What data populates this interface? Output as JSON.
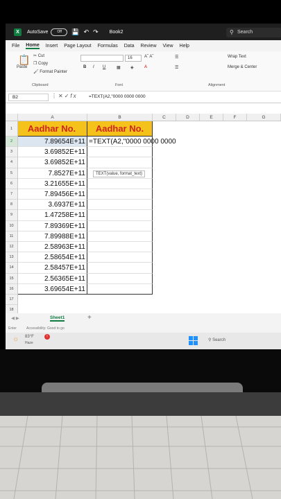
{
  "titlebar": {
    "app_icon": "X",
    "autosave_label": "AutoSave",
    "autosave_state": "Off",
    "book_name": "Book2",
    "search_placeholder": "Search"
  },
  "tabs": [
    "File",
    "Home",
    "Insert",
    "Page Layout",
    "Formulas",
    "Data",
    "Review",
    "View",
    "Help"
  ],
  "active_tab": "Home",
  "ribbon": {
    "cut": "Cut",
    "copy": "Copy",
    "paste": "Paste",
    "format_painter": "Format Painter",
    "clipboard": "Clipboard",
    "font_size": "16",
    "font_group": "Font",
    "wrap_text": "Wrap Text",
    "merge_center": "Merge & Center",
    "alignment": "Alignment"
  },
  "formula_bar": {
    "name_box": "B2",
    "formula": "=TEXT(A2,\"0000 0000 0000"
  },
  "columns": [
    "A",
    "B",
    "C",
    "D",
    "E",
    "F",
    "G"
  ],
  "rows": [
    "1",
    "2",
    "3",
    "4",
    "5",
    "6",
    "7",
    "8",
    "9",
    "10",
    "11",
    "12",
    "13",
    "14",
    "15",
    "16",
    "17",
    "18"
  ],
  "header_a": "Aadhar  No.",
  "header_b": "Aadhar No.",
  "values": [
    "7.89654E+11",
    "3.69852E+11",
    "3.69852E+11",
    "7.8527E+11",
    "3.21655E+11",
    "7.89456E+11",
    "3.6937E+11",
    "1.47258E+11",
    "7.89369E+11",
    "7.89988E+11",
    "2.58963E+11",
    "2.58654E+11",
    "2.58457E+11",
    "2.56365E+11",
    "3.69654E+11"
  ],
  "b2_formula": "=TEXT(A2,\"0000 0000 0000",
  "tooltip": "TEXT(value, format_text)",
  "sheet_tab": "Sheet1",
  "status": {
    "enter": "Enter",
    "accessibility": "Accessibility: Good to go"
  },
  "taskbar": {
    "temp": "83°F",
    "weather": "Haze",
    "search": "Search"
  }
}
